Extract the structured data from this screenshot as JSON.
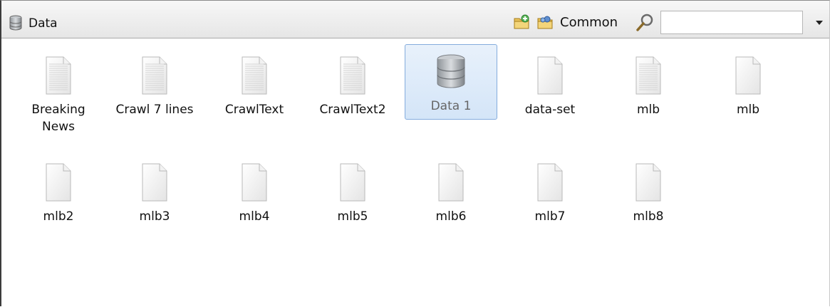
{
  "toolbar": {
    "title": "Data",
    "common_label": "Common",
    "search_value": ""
  },
  "items": [
    {
      "label": "Breaking\nNews",
      "icon": "text-document-icon"
    },
    {
      "label": "Crawl 7 lines",
      "icon": "text-document-icon"
    },
    {
      "label": "CrawlText",
      "icon": "text-document-icon"
    },
    {
      "label": "CrawlText2",
      "icon": "text-document-icon"
    },
    {
      "label": "Data 1",
      "icon": "database-icon",
      "selected": true
    },
    {
      "label": "data-set",
      "icon": "blank-document-icon"
    },
    {
      "label": "mlb",
      "icon": "text-document-icon"
    },
    {
      "label": "mlb",
      "icon": "blank-document-icon"
    },
    {
      "label": "mlb2",
      "icon": "blank-document-icon"
    },
    {
      "label": "mlb3",
      "icon": "blank-document-icon"
    },
    {
      "label": "mlb4",
      "icon": "blank-document-icon"
    },
    {
      "label": "mlb5",
      "icon": "blank-document-icon"
    },
    {
      "label": "mlb6",
      "icon": "blank-document-icon"
    },
    {
      "label": "mlb7",
      "icon": "blank-document-icon"
    },
    {
      "label": "mlb8",
      "icon": "blank-document-icon"
    }
  ],
  "colors": {
    "selection_fill": "#d4e5f8",
    "selection_border": "#84acdd"
  }
}
